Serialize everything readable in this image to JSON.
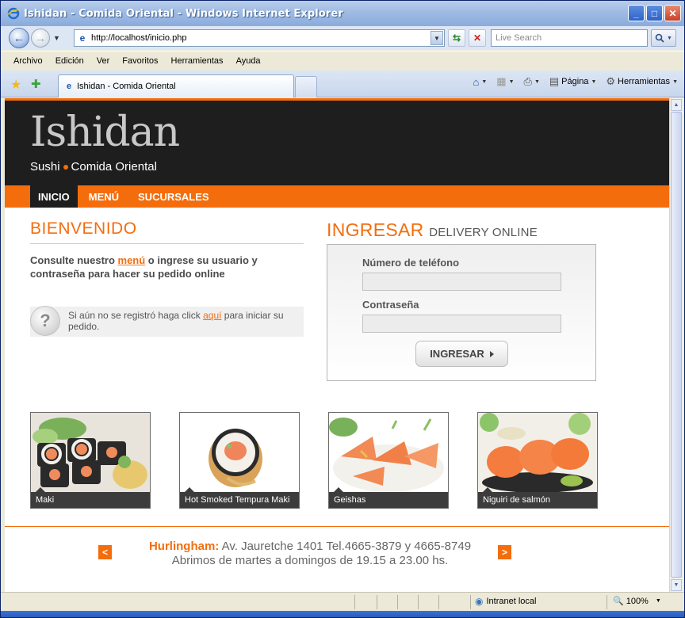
{
  "browser": {
    "window_title": "Ishidan - Comida Oriental - Windows Internet Explorer",
    "url": "http://localhost/inicio.php",
    "search_placeholder": "Live Search",
    "menu": [
      "Archivo",
      "Edición",
      "Ver",
      "Favoritos",
      "Herramientas",
      "Ayuda"
    ],
    "tab_title": "Ishidan - Comida Oriental",
    "commands": {
      "page": "Página",
      "tools": "Herramientas"
    },
    "status": {
      "zone": "Intranet local",
      "zoom": "100%"
    }
  },
  "site": {
    "logo": "Ishidan",
    "tagline_left": "Sushi",
    "tagline_right": "Comida Oriental",
    "nav": [
      "INICIO",
      "MENÚ",
      "SUCURSALES"
    ],
    "welcome": {
      "heading": "BIENVENIDO",
      "intro_before": "Consulte nuestro ",
      "intro_link": "menú",
      "intro_after": " o ingrese su usuario y contraseña para hacer su pedido online",
      "help_before": "Si aún no se registró haga click ",
      "help_link": "aquí",
      "help_after": " para iniciar su pedido."
    },
    "login": {
      "heading": "INGRESAR",
      "subheading": "DELIVERY ONLINE",
      "phone_label": "Número de teléfono",
      "password_label": "Contraseña",
      "submit": "INGRESAR"
    },
    "dishes": [
      "Maki",
      "Hot Smoked Tempura Maki",
      "Geishas",
      "Niguiri de salmón"
    ],
    "footer": {
      "branch": "Hurlingham:",
      "address": " Av. Jauretche 1401 Tel.4665-3879 y 4665-8749",
      "hours": "Abrimos de martes a domingos de 19.15 a 23.00 hs.",
      "prev": "<",
      "next": ">"
    }
  },
  "colors": {
    "accent": "#f46d0d",
    "header_bg": "#1e1e1e"
  }
}
